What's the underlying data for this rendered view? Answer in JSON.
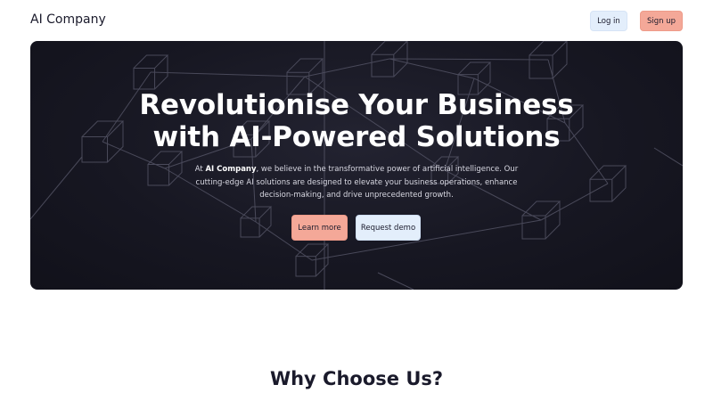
{
  "header": {
    "brand": "AI Company",
    "login_label": "Log in",
    "signup_label": "Sign up"
  },
  "hero": {
    "title_line1": "Revolutionise Your Business",
    "title_line2": "with AI-Powered Solutions",
    "text_prefix": "At ",
    "text_brand": "AI Company",
    "text_body": ", we believe in the transformative power of artificial intelligence. Our cutting-edge AI solutions are designed to elevate your business operations, enhance decision-making, and drive unprecedented growth.",
    "learn_more_label": "Learn more",
    "request_demo_label": "Request demo"
  },
  "why": {
    "title": "Why Choose Us?"
  },
  "colors": {
    "accent_salmon": "#f4a898",
    "accent_light_blue": "#e3eefb",
    "hero_dark": "#171722",
    "text_dark": "#1a1a2b"
  }
}
